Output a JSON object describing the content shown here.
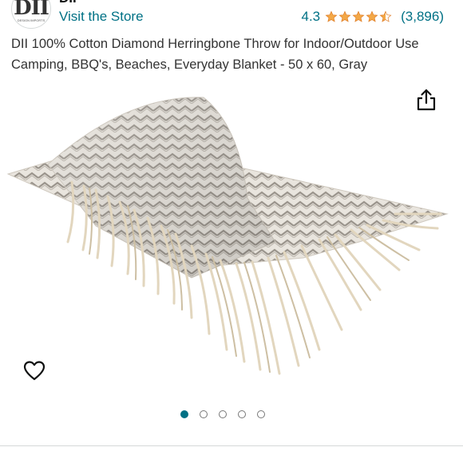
{
  "header": {
    "brand_name": "DII",
    "logo_text": "DII",
    "logo_subtext": "DESIGN IMPORTS",
    "visit_store": "Visit the Store",
    "rating_value": "4.3",
    "rating_stars": 4.3,
    "rating_count": "(3,896)",
    "star_color": "#f3a847"
  },
  "product": {
    "title": "DII 100% Cotton Diamond Herringbone Throw for Indoor/Outdoor Use Camping, BBQ's, Beaches, Everyday Blanket - 50 x 60, Gray"
  },
  "gallery": {
    "image_count": 5,
    "active_index": 0,
    "accent_color": "#007185"
  },
  "icons": {
    "share": "share-icon",
    "wishlist": "heart-outline-icon"
  }
}
